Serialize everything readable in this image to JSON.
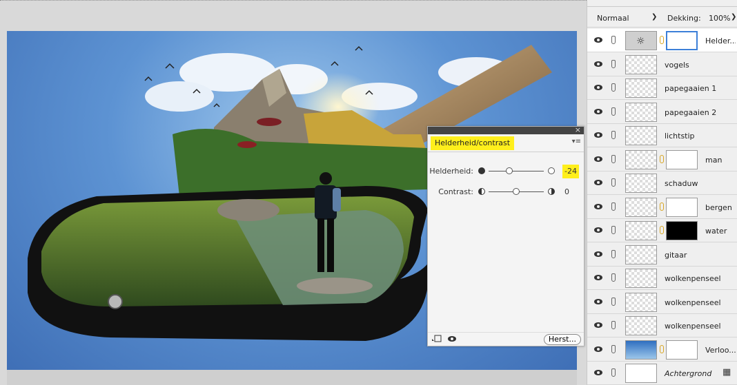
{
  "properties_panel": {
    "title": "Helderheid/contrast",
    "menu_glyph": "▾≡",
    "close_glyph": "×",
    "brightness": {
      "label": "Helderheid:",
      "value": "-24",
      "position": 0.38
    },
    "contrast": {
      "label": "Contrast:",
      "value": "0",
      "position": 0.5
    },
    "reset_label": "Herst..."
  },
  "layers_panel": {
    "blend_mode": "Normaal",
    "opacity_label": "Dekking:",
    "opacity_value": "100%",
    "layers": [
      {
        "name": "Helder...",
        "thumb": "adjustment",
        "mask": "selected",
        "active": true
      },
      {
        "name": "vogels",
        "thumb": "transparent"
      },
      {
        "name": "papegaaien 1",
        "thumb": "transparent"
      },
      {
        "name": "papegaaien 2",
        "thumb": "transparent"
      },
      {
        "name": "lichtstip",
        "thumb": "transparent"
      },
      {
        "name": "man",
        "thumb": "transparent",
        "mask": "white"
      },
      {
        "name": "schaduw",
        "thumb": "transparent"
      },
      {
        "name": "bergen",
        "thumb": "transparent",
        "mask": "white"
      },
      {
        "name": "water",
        "thumb": "transparent",
        "mask": "black"
      },
      {
        "name": "gitaar",
        "thumb": "transparent"
      },
      {
        "name": "wolkenpenseel",
        "thumb": "transparent"
      },
      {
        "name": "wolkenpenseel",
        "thumb": "transparent"
      },
      {
        "name": "wolkenpenseel",
        "thumb": "transparent"
      },
      {
        "name": "Verloo...",
        "thumb": "gradient",
        "mask": "white"
      },
      {
        "name": "Achtergrond",
        "thumb": "plain",
        "italic": true,
        "locked": true
      }
    ]
  },
  "colors": {
    "highlight": "#ffef1c",
    "selection": "#3c7fd8",
    "link": "#d8a520"
  }
}
